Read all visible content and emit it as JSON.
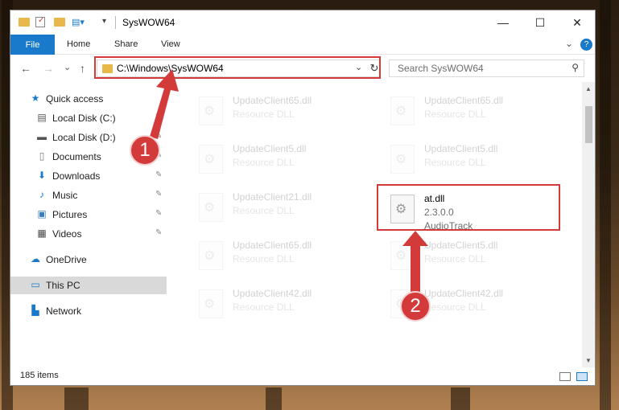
{
  "window": {
    "title": "SysWOW64",
    "minimize_glyph": "—",
    "maximize_glyph": "☐",
    "close_glyph": "✕"
  },
  "ribbon": {
    "file": "File",
    "home": "Home",
    "share": "Share",
    "view": "View",
    "expand_glyph": "⌄",
    "help_glyph": "?"
  },
  "nav": {
    "back_glyph": "←",
    "forward_glyph": "→",
    "recent_glyph": "⌄",
    "up_glyph": "↑"
  },
  "address": {
    "path": "C:\\Windows\\SysWOW64",
    "dropdown_glyph": "⌄",
    "refresh_glyph": "↻"
  },
  "search": {
    "placeholder": "Search SysWOW64",
    "icon_glyph": "⚲"
  },
  "sidebar": {
    "items": [
      {
        "label": "Quick access",
        "icon": "star-icon",
        "glyph": "★"
      },
      {
        "label": "Local Disk (C:)",
        "icon": "disk-icon",
        "glyph": "▤"
      },
      {
        "label": "Local Disk (D:)",
        "icon": "disk-icon",
        "glyph": "▬"
      },
      {
        "label": "Documents",
        "icon": "document-icon",
        "glyph": "▯"
      },
      {
        "label": "Downloads",
        "icon": "download-icon",
        "glyph": "⬇"
      },
      {
        "label": "Music",
        "icon": "music-icon",
        "glyph": "♪"
      },
      {
        "label": "Pictures",
        "icon": "pictures-icon",
        "glyph": "▣"
      },
      {
        "label": "Videos",
        "icon": "videos-icon",
        "glyph": "▦"
      },
      {
        "label": "OneDrive",
        "icon": "cloud-icon",
        "glyph": "☁"
      },
      {
        "label": "This PC",
        "icon": "computer-icon",
        "glyph": "▭"
      },
      {
        "label": "Network",
        "icon": "network-icon",
        "glyph": "▙"
      }
    ],
    "pin_glyph": "✎"
  },
  "files": [
    {
      "name": "UpdateClient65.dll",
      "sub1": "Resource DLL",
      "sub2": ""
    },
    {
      "name": "UpdateClient65.dll",
      "sub1": "Resource DLL",
      "sub2": ""
    },
    {
      "name": "UpdateClient5.dll",
      "sub1": "Resource DLL",
      "sub2": ""
    },
    {
      "name": "UpdateClient5.dll",
      "sub1": "Resource DLL",
      "sub2": ""
    },
    {
      "name": "UpdateClient21.dll",
      "sub1": "Resource DLL",
      "sub2": ""
    },
    {
      "name": "at.dll",
      "sub1": "2.3.0.0",
      "sub2": "AudioTrack"
    },
    {
      "name": "UpdateClient65.dll",
      "sub1": "Resource DLL",
      "sub2": ""
    },
    {
      "name": "UpdateClient5.dll",
      "sub1": "Resource DLL",
      "sub2": ""
    },
    {
      "name": "UpdateClient42.dll",
      "sub1": "Resource DLL",
      "sub2": ""
    },
    {
      "name": "UpdateClient42.dll",
      "sub1": "Resource DLL",
      "sub2": ""
    }
  ],
  "status": {
    "count": "185 items"
  },
  "annotations": {
    "badge1": "1",
    "badge2": "2",
    "color": "#d33b3b"
  },
  "colors": {
    "accent": "#1979ca",
    "folder": "#e8b84a",
    "selected": "#d9d9d9"
  }
}
